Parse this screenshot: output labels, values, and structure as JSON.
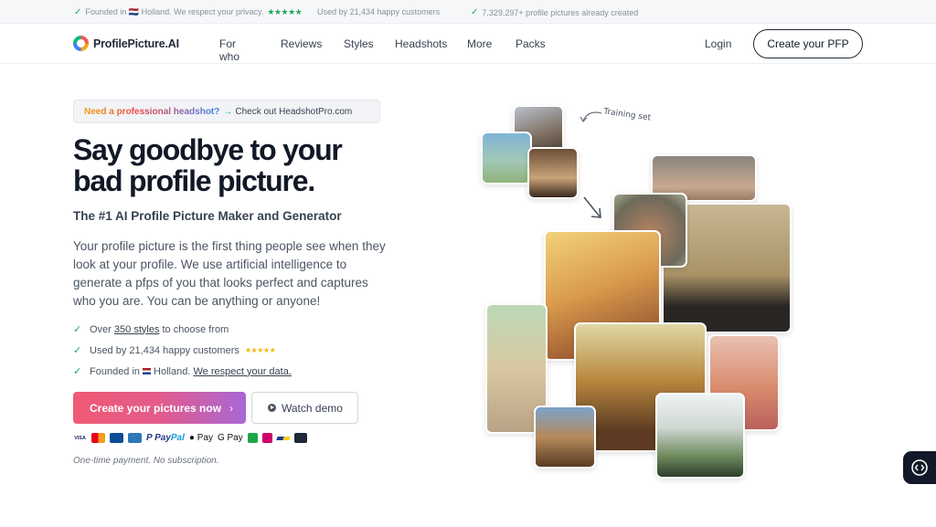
{
  "topbar": {
    "item1": "Founded in 🇳🇱 Holland. We respect your privacy.",
    "item1_stars": "★★★★★",
    "item2": "Used by 21,434 happy customers",
    "item3": "7,329,297+ profile pictures already created"
  },
  "nav": {
    "brand": "ProfilePicture.AI",
    "links": [
      "For who",
      "Reviews",
      "Styles",
      "Headshots",
      "More",
      "Packs"
    ],
    "login": "Login",
    "cta": "Create your PFP"
  },
  "promo": {
    "highlight": "Need a professional headshot?",
    "arrow": "→",
    "text": "Check out HeadshotPro.com"
  },
  "hero": {
    "headline": "Say goodbye to your bad profile picture.",
    "subheadline": "The #1 AI Profile Picture Maker and Generator",
    "description": "Your profile picture is the first thing people see when they look at your profile. We use artificial intelligence to generate a pfps of you that looks perfect and captures who you are. You can be anything or anyone!"
  },
  "checks": {
    "row1_pre": "Over",
    "row1_link": "350 styles",
    "row1_post": "to choose from",
    "row2": "Used by 21,434 happy customers",
    "row2_stars": "★★★★★",
    "row3_pre": "Founded in",
    "row3_country": "Holland.",
    "row3_link": "We respect your data."
  },
  "buttons": {
    "primary": "Create your pictures now",
    "primary_chevron": "›",
    "demo": "Watch demo"
  },
  "payments": {
    "visa": "VISA",
    "paypal_a": "P Pay",
    "paypal_b": "Pal",
    "applepay": " Pay",
    "googlepay": "G Pay"
  },
  "note": "One-time payment. No subscription.",
  "collage": {
    "training_label": "Training set"
  },
  "colors": {
    "accent_gradient_start": "#f05a73",
    "accent_gradient_end": "#a867d6",
    "check_green": "#22a559"
  }
}
